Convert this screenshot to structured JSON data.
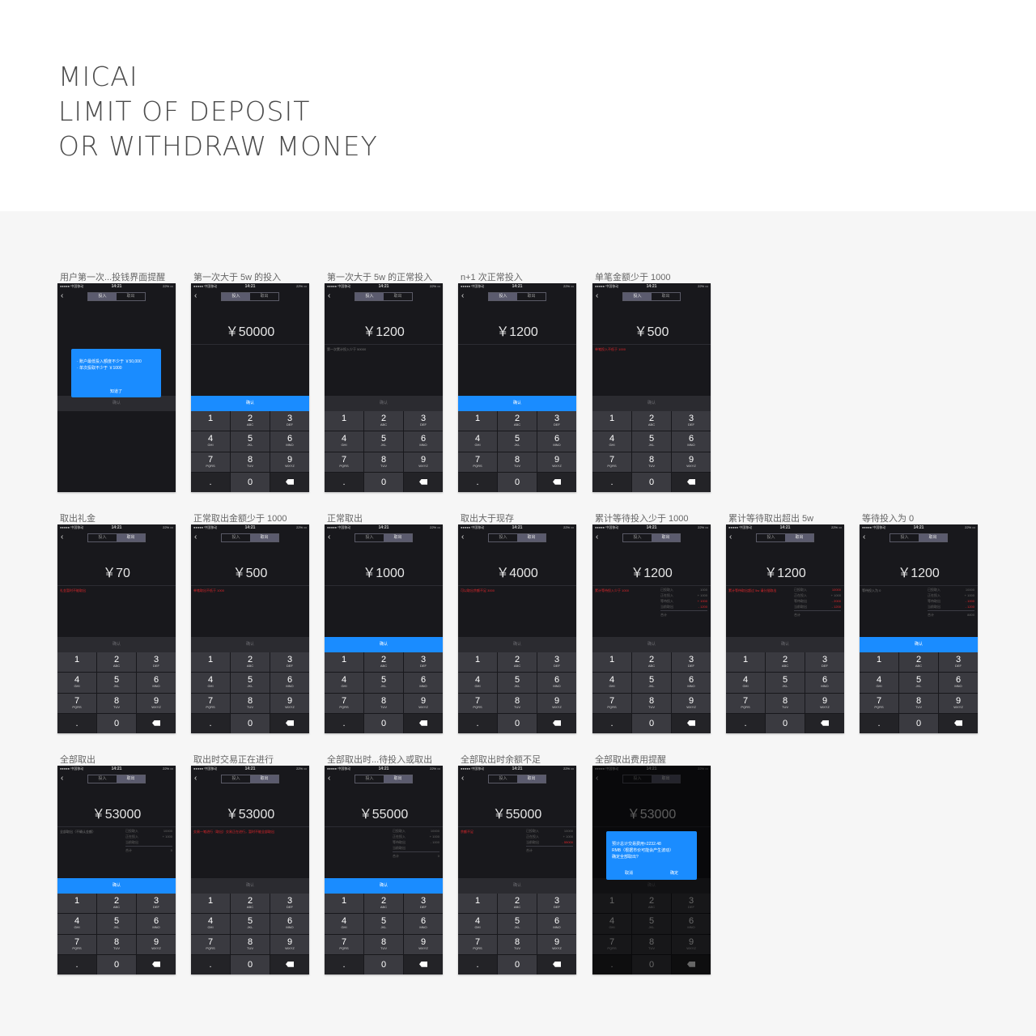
{
  "title": {
    "line1": "MICAI",
    "line2": "LIMIT OF DEPOSIT",
    "line3": "OR WITHDRAW MONEY"
  },
  "status": {
    "carrier": "●●●●● 中国移动",
    "time": "14:21",
    "battery": "22% ▭"
  },
  "common": {
    "back": "‹",
    "tab_deposit": "投入",
    "tab_withdraw": "取出",
    "confirm": "确认",
    "dot": ".",
    "zero": "0"
  },
  "keys": [
    {
      "n": "1",
      "l": ""
    },
    {
      "n": "2",
      "l": "ABC"
    },
    {
      "n": "3",
      "l": "DEF"
    },
    {
      "n": "4",
      "l": "GHI"
    },
    {
      "n": "5",
      "l": "JKL"
    },
    {
      "n": "6",
      "l": "MNO"
    },
    {
      "n": "7",
      "l": "PQRS"
    },
    {
      "n": "8",
      "l": "TUV"
    },
    {
      "n": "9",
      "l": "WXYZ"
    }
  ],
  "screens": [
    {
      "caption": "用户第一次...投钱界面提醒",
      "tab": "deposit",
      "amount": "",
      "hint": "",
      "confirm_active": false,
      "keyboard": false,
      "modal": {
        "text": "· 账户最低投入额度不少于 ￥50,000\n· 单次投取不少于 ￥1000",
        "button": "知道了"
      }
    },
    {
      "caption": "第一次大于 5w 的投入",
      "tab": "deposit",
      "amount": "￥50000",
      "hint": "",
      "confirm_active": true,
      "keyboard": true
    },
    {
      "caption": "第一次大于 5w 的正常投入",
      "tab": "deposit",
      "amount": "￥1200",
      "hint": "第一次累计投入少于 50000",
      "hint_gray": true,
      "confirm_active": false,
      "keyboard": true
    },
    {
      "caption": "n+1 次正常投入",
      "tab": "deposit",
      "amount": "￥1200",
      "hint": "",
      "confirm_active": true,
      "keyboard": true
    },
    {
      "caption": "单笔金额少于 1000",
      "tab": "deposit",
      "amount": "￥500",
      "hint": "单笔投入不低于 1000",
      "confirm_active": false,
      "keyboard": true
    },
    {
      "caption": "取出礼金",
      "tab": "withdraw",
      "amount": "￥70",
      "hint": "礼金暂时不能取出",
      "confirm_active": false,
      "keyboard": true
    },
    {
      "caption": "正常取出金额少于 1000",
      "tab": "withdraw",
      "amount": "￥500",
      "hint": "单笔取出不低于 1000",
      "confirm_active": false,
      "keyboard": true
    },
    {
      "caption": "正常取出",
      "tab": "withdraw",
      "amount": "￥1000",
      "hint": "",
      "confirm_active": true,
      "keyboard": true
    },
    {
      "caption": "取出大于现存",
      "tab": "withdraw",
      "amount": "￥4000",
      "hint": "可以取出余额不足 3000",
      "confirm_active": false,
      "keyboard": true
    },
    {
      "caption": "累计等待投入少于 1000",
      "tab": "withdraw",
      "amount": "￥1200",
      "hint": "累计等待投入少于 1000",
      "confirm_active": false,
      "keyboard": true,
      "stats": [
        {
          "k": "已投取入",
          "v": "1000",
          "red": false
        },
        {
          "k": "正在投入",
          "v": "+ 1000",
          "red": false
        },
        {
          "k": "等待投入",
          "v": "+ 1000",
          "red": true
        },
        {
          "k": "当前取出",
          "v": "- 1200",
          "red": true
        },
        {
          "k": "合计",
          "v": "",
          "red": false
        }
      ]
    },
    {
      "caption": "累计等待取出超出 5w",
      "tab": "withdraw",
      "amount": "￥1200",
      "hint": "累计等待取出超过 5w 请分批取出",
      "confirm_active": false,
      "keyboard": true,
      "stats": [
        {
          "k": "已投取入",
          "v": "10000",
          "red": true
        },
        {
          "k": "正在投入",
          "v": "+ 1000",
          "red": false
        },
        {
          "k": "等待取出",
          "v": "- 2000",
          "red": true
        },
        {
          "k": "当前取出",
          "v": "- 1200",
          "red": true
        },
        {
          "k": "合计",
          "v": "",
          "red": false
        }
      ]
    },
    {
      "caption": "等待投入为 0",
      "tab": "withdraw",
      "amount": "￥1200",
      "hint": "等待投入为 0",
      "hint_gray": true,
      "confirm_active": true,
      "keyboard": true,
      "stats": [
        {
          "k": "已投取入",
          "v": "10000",
          "red": false
        },
        {
          "k": "正在投入",
          "v": "+ 1000",
          "red": false
        },
        {
          "k": "等待取出",
          "v": "- 1000",
          "red": true
        },
        {
          "k": "当前取出",
          "v": "- 1200",
          "red": true
        },
        {
          "k": "合计",
          "v": "8800",
          "red": false
        }
      ]
    },
    {
      "caption": "全部取出",
      "tab": "withdraw",
      "amount": "￥53000",
      "hint": "全部取出（不确认金额）",
      "hint_gray": true,
      "confirm_active": true,
      "keyboard": true,
      "stats": [
        {
          "k": "已投取入",
          "v": "10000",
          "red": false
        },
        {
          "k": "正在投入",
          "v": "+ 1000",
          "red": false
        },
        {
          "k": "当前取出",
          "v": "",
          "red": false
        },
        {
          "k": "合计",
          "v": "0",
          "red": false
        }
      ]
    },
    {
      "caption": "取出时交易正在进行",
      "tab": "withdraw",
      "amount": "￥53000",
      "hint": "交易一笔进行（取出）交易正在进行，暂时不能全部取出",
      "confirm_active": false,
      "keyboard": true
    },
    {
      "caption": "全部取出时...待投入或取出",
      "tab": "withdraw",
      "amount": "￥55000",
      "hint": "",
      "confirm_active": true,
      "keyboard": true,
      "stats": [
        {
          "k": "已投取入",
          "v": "10000",
          "red": false
        },
        {
          "k": "正在投入",
          "v": "+ 1000",
          "red": false
        },
        {
          "k": "等待取出",
          "v": "- 1000",
          "red": false
        },
        {
          "k": "当前取出",
          "v": "",
          "red": false
        },
        {
          "k": "合计",
          "v": "0",
          "red": false
        }
      ]
    },
    {
      "caption": "全部取出时余额不足",
      "tab": "withdraw",
      "amount": "￥55000",
      "hint": "余额不足",
      "confirm_active": false,
      "keyboard": true,
      "stats": [
        {
          "k": "已投取入",
          "v": "10000",
          "red": false
        },
        {
          "k": "正在投入",
          "v": "+ 1000",
          "red": false
        },
        {
          "k": "当前取出",
          "v": "- 55000",
          "red": true
        },
        {
          "k": "合计",
          "v": "",
          "red": false
        }
      ]
    },
    {
      "caption": "全部取出费用提醒",
      "tab": "withdraw",
      "amount": "￥53000",
      "hint": "",
      "confirm_active": false,
      "keyboard": true,
      "dim": true,
      "modal": {
        "text": "预计总计交易费用≈2232.48\nRMB（根据市价可能会产生波动）\n确定全部取出?",
        "cancel": "取消",
        "ok": "确定"
      }
    }
  ]
}
